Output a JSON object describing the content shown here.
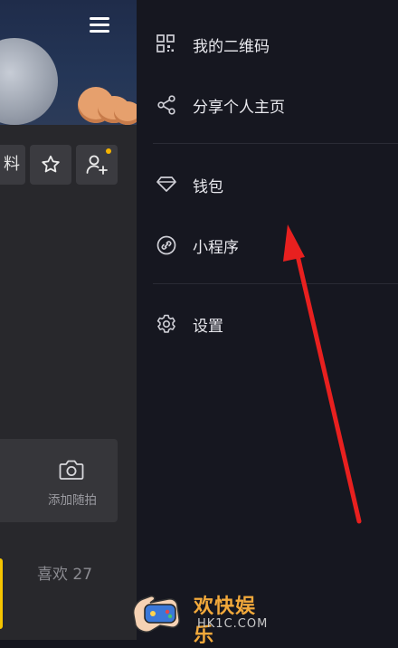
{
  "left_panel": {
    "edit_profile_partial": "料",
    "snap_label": "添加随拍",
    "likes_label": "喜欢 27"
  },
  "menu": {
    "items": [
      {
        "label": "我的二维码",
        "icon": "qr-code-icon"
      },
      {
        "label": "分享个人主页",
        "icon": "share-icon"
      },
      {
        "label": "钱包",
        "icon": "diamond-wallet-icon"
      },
      {
        "label": "小程序",
        "icon": "link-icon"
      },
      {
        "label": "设置",
        "icon": "gear-icon"
      }
    ]
  },
  "watermark": {
    "title": "欢快娱乐",
    "domain": "HK1C.COM"
  },
  "colors": {
    "menu_bg": "#161720",
    "menu_text": "#e9e9ee",
    "annotation_arrow": "#e8201f",
    "notification_dot": "#f5b301",
    "watermark_text": "#f2a93b"
  }
}
